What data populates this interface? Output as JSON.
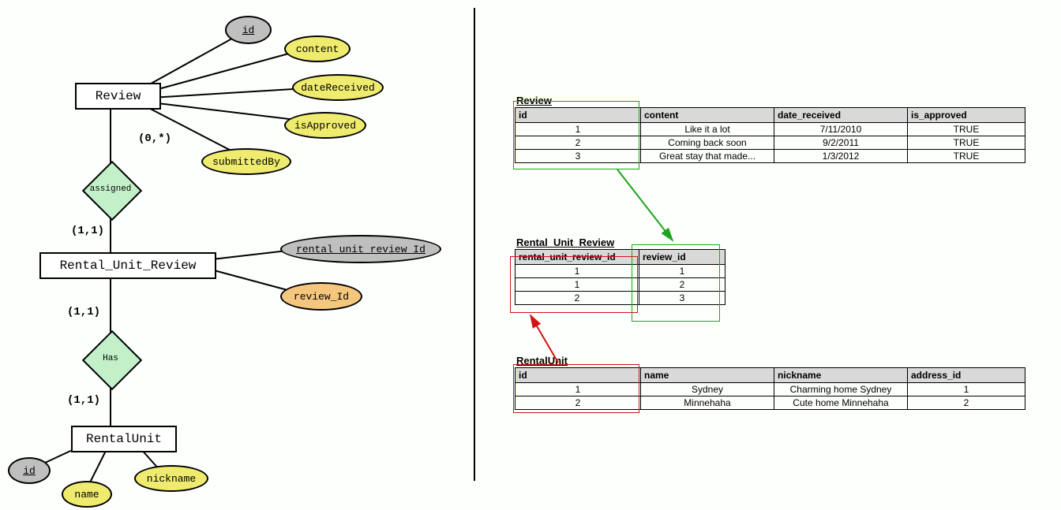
{
  "er": {
    "entities": {
      "review": "Review",
      "rur": "Rental_Unit_Review",
      "rentalunit": "RentalUnit"
    },
    "relationships": {
      "assigned": "assigned",
      "has": "Has"
    },
    "attributes": {
      "review_id": "id",
      "content": "content",
      "dateReceived": "dateReceived",
      "isApproved": "isApproved",
      "submittedBy": "submittedBy",
      "rur_id": "rental_unit_review_Id",
      "review_fk": "review_Id",
      "ru_id": "id",
      "ru_name": "name",
      "ru_nickname": "nickname"
    },
    "cardinalities": {
      "c1": "(0,*)",
      "c2": "(1,1)",
      "c3": "(1,1)",
      "c4": "(1,1)"
    }
  },
  "tables": {
    "review": {
      "title": "Review",
      "columns": [
        "id",
        "content",
        "date_received",
        "is_approved"
      ],
      "rows": [
        [
          "1",
          "Like it a lot",
          "7/11/2010",
          "TRUE"
        ],
        [
          "2",
          "Coming back soon",
          "9/2/2011",
          "TRUE"
        ],
        [
          "3",
          "Great stay that made...",
          "1/3/2012",
          "TRUE"
        ]
      ]
    },
    "rur": {
      "title": "Rental_Unit_Review",
      "columns": [
        "rental_unit_review_id",
        "review_id"
      ],
      "rows": [
        [
          "1",
          "1"
        ],
        [
          "1",
          "2"
        ],
        [
          "2",
          "3"
        ]
      ]
    },
    "rentalunit": {
      "title": "RentalUnit",
      "columns": [
        "id",
        "name",
        "nickname",
        "address_id"
      ],
      "rows": [
        [
          "1",
          "Sydney",
          "Charming home Sydney",
          "1"
        ],
        [
          "2",
          "Minnehaha",
          "Cute home Minnehaha",
          "2"
        ]
      ]
    }
  }
}
